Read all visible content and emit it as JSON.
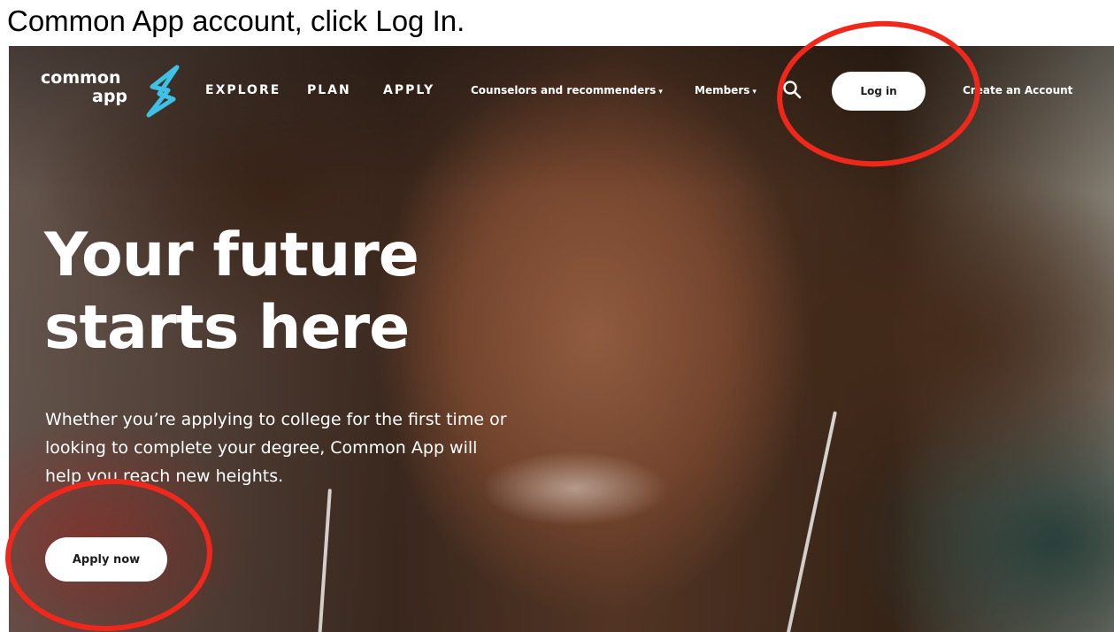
{
  "caption": {
    "text": "Common App account, click Log In."
  },
  "header": {
    "logo_line1": "common",
    "logo_line2": "app",
    "nav": [
      {
        "label": "EXPLORE"
      },
      {
        "label": "PLAN"
      },
      {
        "label": "APPLY"
      }
    ],
    "dropdowns": [
      {
        "label": "Counselors and recommenders",
        "caret": "▾"
      },
      {
        "label": "Members",
        "caret": "▾"
      }
    ],
    "search_icon": "search-icon",
    "login_label": "Log in",
    "create_account_label": "Create an Account"
  },
  "hero": {
    "title_line1": "Your future",
    "title_line2": "starts here",
    "subtitle_lines": [
      "Whether you’re applying to college for the first time or",
      "looking to complete your degree, Common App will",
      "help you reach new heights."
    ],
    "cta_label": "Apply now"
  },
  "annotations": {
    "color": "#f0281b",
    "targets": [
      "login-button",
      "apply-now-button"
    ]
  },
  "colors": {
    "logo_accent": "#3fc1e6",
    "button_bg": "#ffffff",
    "button_text": "#1d1d1d"
  }
}
